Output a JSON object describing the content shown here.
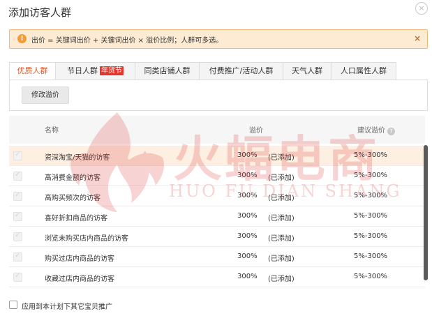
{
  "dialog": {
    "title": "添加访客人群",
    "close_label": "×"
  },
  "notice": {
    "icon": "!",
    "text": "出价 = 关键词出价 + 关键词出价 × 溢价比例；人群可多选。",
    "close_label": "×"
  },
  "tabs": [
    {
      "label": "优质人群",
      "active": true
    },
    {
      "label": "节日人群",
      "badge": "年货节"
    },
    {
      "label": "同类店铺人群"
    },
    {
      "label": "付费推广/活动人群"
    },
    {
      "label": "天气人群"
    },
    {
      "label": "人口属性人群"
    }
  ],
  "toolbar": {
    "modify_label": "修改溢价"
  },
  "table": {
    "headers": {
      "name": "名称",
      "premium": "溢价",
      "suggest": "建议溢价",
      "help": "?"
    },
    "rows": [
      {
        "name": "资深淘宝/天猫的访客",
        "premium": "300%",
        "status": "(已添加)",
        "suggest": "5%-300%"
      },
      {
        "name": "高消费金额的访客",
        "premium": "300%",
        "status": "(已添加)",
        "suggest": "5%-300%"
      },
      {
        "name": "高购买频次的访客",
        "premium": "300%",
        "status": "(已添加)",
        "suggest": "5%-300%"
      },
      {
        "name": "喜好折扣商品的访客",
        "premium": "300%",
        "status": "(已添加)",
        "suggest": "5%-300%"
      },
      {
        "name": "浏览未购买店内商品的访客",
        "premium": "300%",
        "status": "(已添加)",
        "suggest": "5%-300%"
      },
      {
        "name": "购买过店内商品的访客",
        "premium": "300%",
        "status": "(已添加)",
        "suggest": "5%-300%"
      },
      {
        "name": "收藏过店内商品的访客",
        "premium": "300%",
        "status": "(已添加)",
        "suggest": "5%-300%"
      }
    ]
  },
  "watermark": {
    "text_cn": "火蝠电商",
    "text_en": "HUO FU DIAN SHANG"
  },
  "footer": {
    "apply_label": "应用到本计划下其它宝贝推广"
  },
  "colors": {
    "accent": "#e05c2e",
    "notice_bg": "#fdebd3",
    "notice_border": "#f4b776",
    "badge": "#e8352b",
    "watermark": "#e23b3b"
  }
}
